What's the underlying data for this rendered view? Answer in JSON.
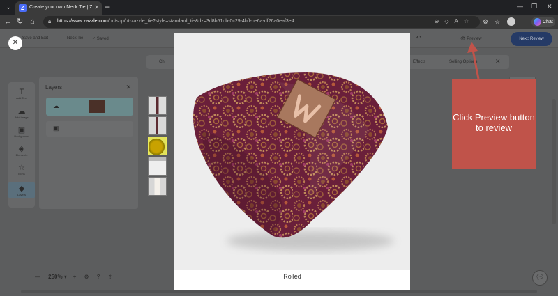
{
  "browser": {
    "tab_title": "Create your own Neck Tie | Zazzle",
    "tab_favicon": "Z",
    "new_tab": "+",
    "url_host": "https://www.zazzle.com",
    "url_path": "/pd/spp/pt-zazzle_tie?style=standard_tie&dz=3d8b51db-0c29-4bff-be6a-df26a0eaf3e4",
    "chat_label": "Chat",
    "icons": [
      "tab-menu-icon",
      "back-icon",
      "forward-icon",
      "reload-icon",
      "home-icon",
      "lock-icon",
      "extensions-icon",
      "favorites-icon",
      "profile-icon",
      "more-icon"
    ]
  },
  "app": {
    "save_exit": "Save and Exit",
    "breadcrumb": "Neck Tie",
    "saved": "Saved",
    "preview": "Preview",
    "next": "Next: Review",
    "toolstrip_left": "Ch",
    "toolstrip_effects": "Effects",
    "toolstrip_selling": "Selling Options",
    "sidebar": [
      {
        "label": "Add Text",
        "icon": "T"
      },
      {
        "label": "Add Image",
        "icon": "☁"
      },
      {
        "label": "Background",
        "icon": "▣"
      },
      {
        "label": "Elements",
        "icon": "◈"
      },
      {
        "label": "Icons",
        "icon": "☆"
      },
      {
        "label": "Layers",
        "icon": "◆"
      }
    ],
    "layers_title": "Layers",
    "zoom": "250%"
  },
  "modal": {
    "close": "✕",
    "caption": "Rolled"
  },
  "annotation": {
    "text": "Click Preview button to review",
    "color": "#c0534a"
  },
  "colors": {
    "tie_base": "#6a1f3a",
    "gear": "#b87a50",
    "monogram_bg": "#a8785e"
  }
}
